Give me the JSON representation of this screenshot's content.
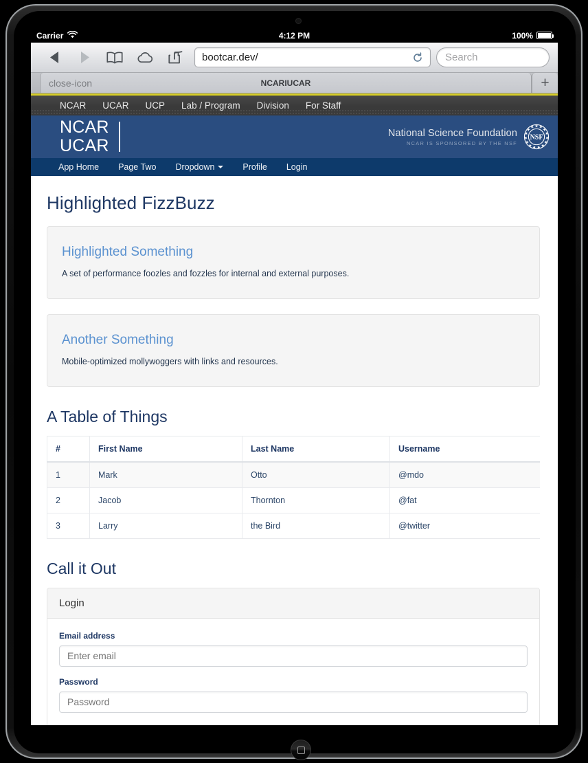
{
  "status_bar": {
    "carrier": "Carrier",
    "wifi_icon": "wifi-icon",
    "time": "4:12 PM",
    "battery_percent": "100%",
    "battery_icon": "battery-full-icon"
  },
  "browser": {
    "back_icon": "back-arrow-icon",
    "forward_icon": "forward-arrow-icon",
    "bookmarks_icon": "book-icon",
    "icloud_icon": "cloud-icon",
    "share_icon": "share-icon",
    "url": "bootcar.dev/",
    "reload_icon": "reload-icon",
    "search_placeholder": "Search",
    "tab_close_icon": "close-icon",
    "tab_title": "NCARIUCAR",
    "new_tab_icon": "plus-icon"
  },
  "util_nav": {
    "items": [
      {
        "label": "NCAR"
      },
      {
        "label": "UCAR"
      },
      {
        "label": "UCP"
      },
      {
        "label": "Lab / Program"
      },
      {
        "label": "Division"
      },
      {
        "label": "For Staff"
      }
    ]
  },
  "banner": {
    "logo_line1": "NCAR",
    "logo_line2": "UCAR",
    "nsf_name": "National Science Foundation",
    "nsf_sub": "NCAR IS SPONSORED BY THE NSF",
    "nsf_seal_text": "NSF",
    "background_color": "#2a4d80"
  },
  "app_nav": {
    "items": [
      {
        "label": "App Home",
        "has_caret": false
      },
      {
        "label": "Page Two",
        "has_caret": false
      },
      {
        "label": "Dropdown",
        "has_caret": true
      },
      {
        "label": "Profile",
        "has_caret": false
      },
      {
        "label": "Login",
        "has_caret": false
      }
    ],
    "background_color": "#0d3a6b"
  },
  "main": {
    "page_title": "Highlighted FizzBuzz",
    "panels": [
      {
        "heading": "Highlighted Something",
        "text": "A set of performance foozles and fozzles for internal and external purposes."
      },
      {
        "heading": "Another Something",
        "text": "Mobile-optimized mollywoggers with links and resources."
      }
    ],
    "table_section": {
      "title": "A Table of Things",
      "columns": [
        "#",
        "First Name",
        "Last Name",
        "Username"
      ],
      "rows": [
        [
          "1",
          "Mark",
          "Otto",
          "@mdo"
        ],
        [
          "2",
          "Jacob",
          "Thornton",
          "@fat"
        ],
        [
          "3",
          "Larry",
          "the Bird",
          "@twitter"
        ]
      ]
    },
    "callout_section": {
      "title": "Call it Out",
      "well_header": "Login",
      "fields": [
        {
          "label": "Email address",
          "placeholder": "Enter email",
          "value": ""
        },
        {
          "label": "Password",
          "placeholder": "Password",
          "value": ""
        }
      ]
    },
    "heading_color": "#1f3864",
    "link_color": "#5b92d0"
  }
}
